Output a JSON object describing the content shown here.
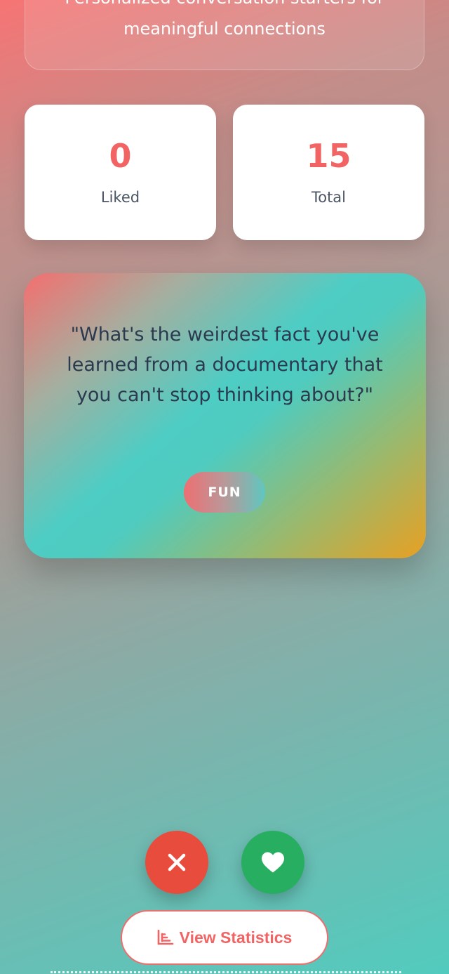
{
  "header": {
    "subtitle_line1": "Personalized conversation starters for",
    "subtitle_line2": "meaningful connections"
  },
  "stats": {
    "liked_value": "0",
    "liked_label": "Liked",
    "total_value": "15",
    "total_label": "Total"
  },
  "card": {
    "question": "\"What's the weirdest fact you've learned from a documentary that you can't stop thinking about?\"",
    "category": "FUN"
  },
  "actions": {
    "dislike_icon": "close-icon",
    "like_icon": "heart-icon",
    "view_stats_label": "View Statistics",
    "view_stats_icon": "bar-chart-icon"
  },
  "colors": {
    "accent": "#f26464",
    "dislike": "#e84c3d",
    "like": "#27ae60",
    "text_dark": "#2b3a4f"
  }
}
